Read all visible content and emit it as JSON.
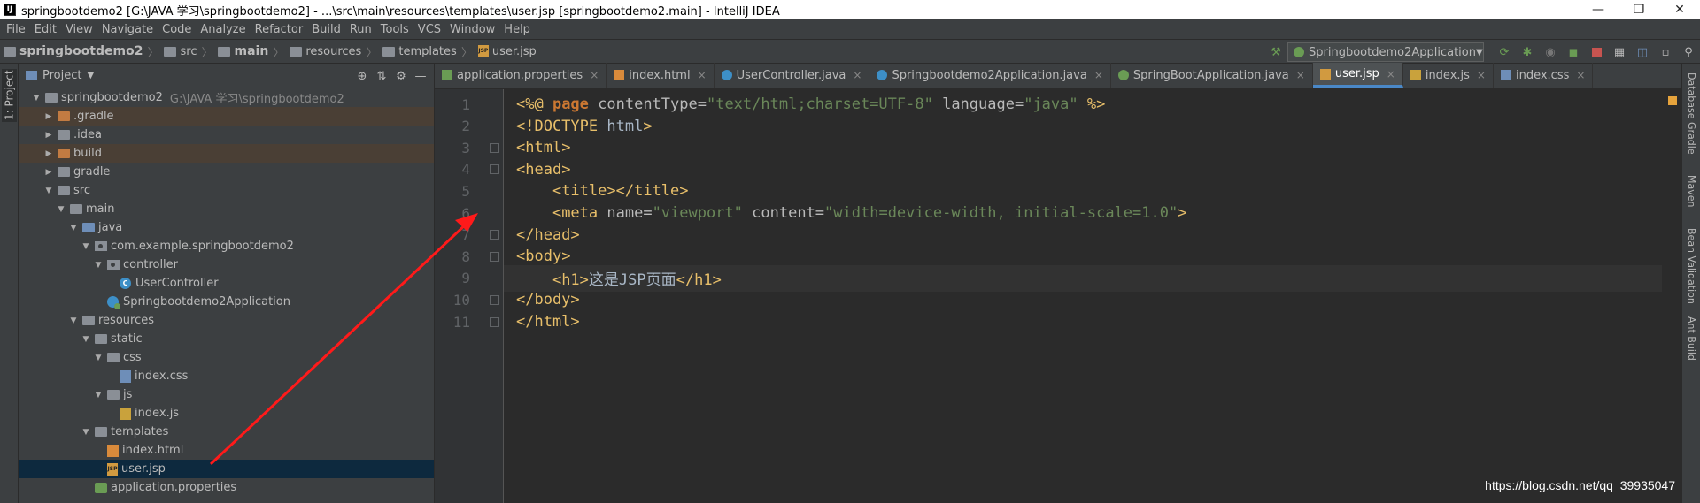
{
  "window": {
    "title": "springbootdemo2 [G:\\JAVA 学习\\springbootdemo2] - ...\\src\\main\\resources\\templates\\user.jsp [springbootdemo2.main] - IntelliJ IDEA",
    "app_icon_text": "IJ"
  },
  "menu": [
    "File",
    "Edit",
    "View",
    "Navigate",
    "Code",
    "Analyze",
    "Refactor",
    "Build",
    "Run",
    "Tools",
    "VCS",
    "Window",
    "Help"
  ],
  "breadcrumb": [
    "springbootdemo2",
    "src",
    "main",
    "resources",
    "templates",
    "user.jsp"
  ],
  "run_config": "Springbootdemo2Application",
  "left_tool": {
    "project_tab": "1: Project"
  },
  "project_panel": {
    "header": "Project",
    "tree": [
      {
        "label": "springbootdemo2",
        "path": "G:\\JAVA 学习\\springbootdemo2",
        "depth": 0,
        "expanded": true,
        "icon": "folder-icon"
      },
      {
        "label": ".gradle",
        "depth": 1,
        "expanded": false,
        "icon": "folder-orange-icon",
        "excluded": true
      },
      {
        "label": ".idea",
        "depth": 1,
        "expanded": false,
        "icon": "folder-icon"
      },
      {
        "label": "build",
        "depth": 1,
        "expanded": false,
        "icon": "folder-orange-icon",
        "excluded": true
      },
      {
        "label": "gradle",
        "depth": 1,
        "expanded": false,
        "icon": "folder-icon"
      },
      {
        "label": "src",
        "depth": 1,
        "expanded": true,
        "icon": "folder-icon"
      },
      {
        "label": "main",
        "depth": 2,
        "expanded": true,
        "icon": "folder-icon"
      },
      {
        "label": "java",
        "depth": 3,
        "expanded": true,
        "icon": "folder-blue-icon"
      },
      {
        "label": "com.example.springbootdemo2",
        "depth": 4,
        "expanded": true,
        "icon": "package-icon"
      },
      {
        "label": "controller",
        "depth": 5,
        "expanded": true,
        "icon": "package-icon"
      },
      {
        "label": "UserController",
        "depth": 6,
        "icon": "class-icon"
      },
      {
        "label": "Springbootdemo2Application",
        "depth": 5,
        "icon": "spring-class-icon"
      },
      {
        "label": "resources",
        "depth": 3,
        "expanded": true,
        "icon": "folder-icon"
      },
      {
        "label": "static",
        "depth": 4,
        "expanded": true,
        "icon": "folder-icon"
      },
      {
        "label": "css",
        "depth": 5,
        "expanded": true,
        "icon": "folder-icon"
      },
      {
        "label": "index.css",
        "depth": 6,
        "icon": "css-file-icon"
      },
      {
        "label": "js",
        "depth": 5,
        "expanded": true,
        "icon": "folder-icon"
      },
      {
        "label": "index.js",
        "depth": 6,
        "icon": "js-file-icon"
      },
      {
        "label": "templates",
        "depth": 4,
        "expanded": true,
        "icon": "folder-icon"
      },
      {
        "label": "index.html",
        "depth": 5,
        "icon": "html-file-icon"
      },
      {
        "label": "user.jsp",
        "depth": 5,
        "icon": "jsp-file-icon",
        "selected": true
      },
      {
        "label": "application.properties",
        "depth": 4,
        "icon": "properties-file-icon"
      }
    ]
  },
  "tabs": [
    {
      "label": "application.properties",
      "icon": "properties"
    },
    {
      "label": "index.html",
      "icon": "html"
    },
    {
      "label": "UserController.java",
      "icon": "class"
    },
    {
      "label": "Springbootdemo2Application.java",
      "icon": "spring"
    },
    {
      "label": "SpringBootApplication.java",
      "icon": "spring-lib"
    },
    {
      "label": "user.jsp",
      "icon": "jsp",
      "active": true
    },
    {
      "label": "index.js",
      "icon": "js"
    },
    {
      "label": "index.css",
      "icon": "css"
    }
  ],
  "code_lines": [
    {
      "n": "1",
      "text": "<%@ page contentType=\"text/html;charset=UTF-8\" language=\"java\" %>"
    },
    {
      "n": "2",
      "text": "<!DOCTYPE html>"
    },
    {
      "n": "3",
      "text": "<html>"
    },
    {
      "n": "4",
      "text": "<head>"
    },
    {
      "n": "5",
      "text": "    <title></title>"
    },
    {
      "n": "6",
      "text": "    <meta name=\"viewport\" content=\"width=device-width, initial-scale=1.0\">"
    },
    {
      "n": "7",
      "text": "</head>"
    },
    {
      "n": "8",
      "text": "<body>"
    },
    {
      "n": "9",
      "text": "    <h1>这是JSP页面</h1>"
    },
    {
      "n": "10",
      "text": "</body>"
    },
    {
      "n": "11",
      "text": "</html>"
    }
  ],
  "right_tools": [
    "Database",
    "Gradle",
    "Maven",
    "Bean Validation",
    "Ant Build"
  ],
  "watermark": "https://blog.csdn.net/qq_39935047",
  "colors": {
    "accent": "#4a88c7",
    "annotation_arrow": "#ff1a1a",
    "selection": "#0d293e"
  }
}
